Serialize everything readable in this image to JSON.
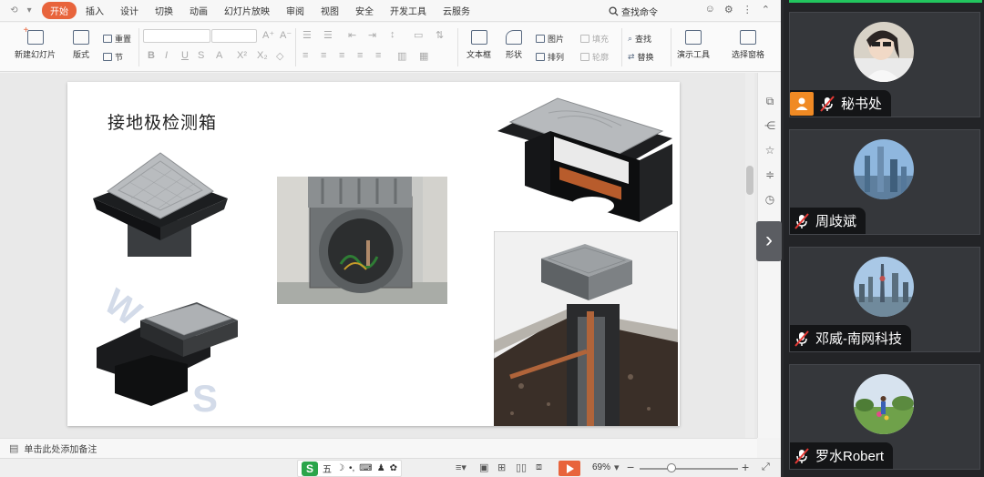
{
  "tabs": [
    "开始",
    "插入",
    "设计",
    "切换",
    "动画",
    "幻灯片放映",
    "审阅",
    "视图",
    "安全",
    "开发工具",
    "云服务"
  ],
  "active_tab": "开始",
  "search_label": "查找命令",
  "ribbon": {
    "new_slide": "新建幻灯片",
    "layout": "版式",
    "reset": "重置",
    "section": "节",
    "textbox": "文本框",
    "shape": "形状",
    "picture": "图片",
    "arrange": "排列",
    "fill": "填充",
    "outline": "轮廓",
    "find": "查找",
    "replace": "替换",
    "demo_tools": "演示工具",
    "select_pane": "选择窗格"
  },
  "slide": {
    "title": "接地极检测箱"
  },
  "notes_placeholder": "单击此处添加备注",
  "statusbar": {
    "ime_label": "五",
    "zoom": "69%"
  },
  "participants": [
    {
      "name": "秘书处",
      "host": true,
      "muted": true,
      "avatar": "portrait-avatar"
    },
    {
      "name": "周歧斌",
      "host": false,
      "muted": true,
      "avatar": "city-avatar"
    },
    {
      "name": "邓威-南网科技",
      "host": false,
      "muted": true,
      "avatar": "skyline-avatar"
    },
    {
      "name": "罗水Robert",
      "host": false,
      "muted": true,
      "avatar": "garden-avatar"
    }
  ],
  "colors": {
    "accent": "#e8643c",
    "host_badge": "#f08a24",
    "active_speaker": "#22c55e",
    "mute_red": "#e53935"
  }
}
